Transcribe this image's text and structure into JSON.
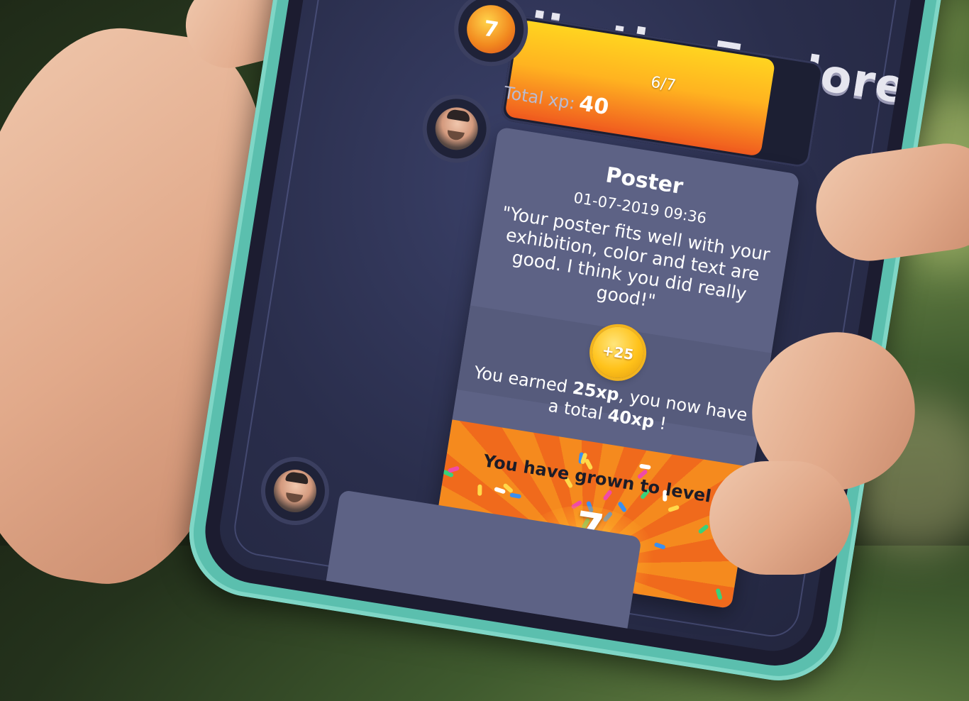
{
  "app": {
    "title": "Julie the Explorer"
  },
  "level": {
    "current": "7",
    "progress_text": "6/7",
    "progress_fraction": 0.857,
    "total_xp_label": "Total xp:",
    "total_xp_value": "40"
  },
  "messages": [
    {
      "title": "Poster",
      "date": "01-07-2019 09:36",
      "quote": "\"Your poster fits well with your exhibition, color and text are good. I think you did really good!\"",
      "xp_badge": "+25",
      "earned_prefix": "You earned ",
      "earned_xp": "25xp",
      "earned_middle": ", you now have a total ",
      "earned_total": "40xp",
      "earned_suffix": " !",
      "levelup_text": "You have grown to level",
      "levelup_level": "7"
    }
  ],
  "colors": {
    "screen_bg": "#2a2e4c",
    "card_bg": "#5d6285",
    "xp_bar_start": "#ffd420",
    "xp_bar_end": "#f05a1f",
    "levelup_bg": "#f58a1e",
    "phone_case": "#5bbfae"
  },
  "icons": {
    "level_badge": "level-badge-icon",
    "xp_coin": "coin-icon",
    "avatar": "user-avatar"
  }
}
